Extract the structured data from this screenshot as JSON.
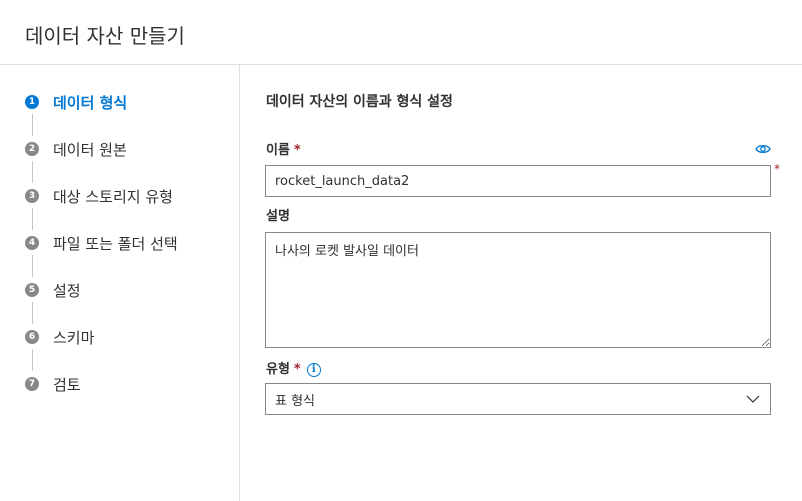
{
  "header": {
    "title": "데이터 자산 만들기"
  },
  "steps": [
    {
      "number": "1",
      "label": "데이터 형식",
      "active": true
    },
    {
      "number": "2",
      "label": "데이터 원본",
      "active": false
    },
    {
      "number": "3",
      "label": "대상 스토리지 유형",
      "active": false
    },
    {
      "number": "4",
      "label": "파일 또는 폴더 선택",
      "active": false
    },
    {
      "number": "5",
      "label": "설정",
      "active": false
    },
    {
      "number": "6",
      "label": "스키마",
      "active": false
    },
    {
      "number": "7",
      "label": "검토",
      "active": false
    }
  ],
  "form": {
    "section_title": "데이터 자산의 이름과 형식 설정",
    "required_marker": "*",
    "name": {
      "label": "이름",
      "value": "rocket_launch_data2"
    },
    "description": {
      "label": "설명",
      "value": "나사의 로켓 발사일 데이터"
    },
    "type": {
      "label": "유형",
      "info_symbol": "i",
      "selected": "표 형식"
    }
  },
  "icons": {
    "step_complete": "step-number-badge",
    "visibility": "eye-icon",
    "info": "info-icon",
    "dropdown": "chevron-down-icon"
  },
  "colors": {
    "accent": "#0078d4",
    "required": "#a4262c",
    "step_inactive": "#8a8886",
    "border": "#8a8886",
    "divider": "#e1dfdd"
  }
}
